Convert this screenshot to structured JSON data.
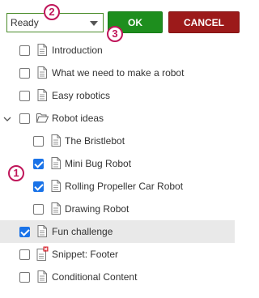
{
  "toolbar": {
    "status_value": "Ready",
    "ok_label": "OK",
    "cancel_label": "CANCEL"
  },
  "callouts": [
    "2",
    "3",
    "1"
  ],
  "tree": {
    "items": [
      {
        "label": "Introduction",
        "checked": false,
        "icon": "page-icon"
      },
      {
        "label": "What we need to make a robot",
        "checked": false,
        "icon": "page-icon"
      },
      {
        "label": "Easy robotics",
        "checked": false,
        "icon": "page-icon"
      },
      {
        "label": "Robot ideas",
        "checked": false,
        "icon": "folder-open-icon",
        "expanded": true
      },
      {
        "label": "The Bristlebot",
        "checked": false,
        "icon": "page-icon"
      },
      {
        "label": "Mini Bug Robot",
        "checked": true,
        "icon": "page-icon"
      },
      {
        "label": "Rolling Propeller Car Robot",
        "checked": true,
        "icon": "page-icon"
      },
      {
        "label": "Drawing Robot",
        "checked": false,
        "icon": "page-icon"
      },
      {
        "label": "Fun challenge",
        "checked": true,
        "icon": "",
        "highlighted": true
      },
      {
        "label": "Snippet: Footer",
        "checked": false,
        "icon": "snippet-error-icon"
      },
      {
        "label": "Conditional Content",
        "checked": false,
        "icon": "page-icon"
      }
    ]
  },
  "colors": {
    "ok": "#1e8e1e",
    "cancel": "#9c1a1a",
    "callout": "#c0165a",
    "checkbox_checked": "#1a73e8"
  }
}
